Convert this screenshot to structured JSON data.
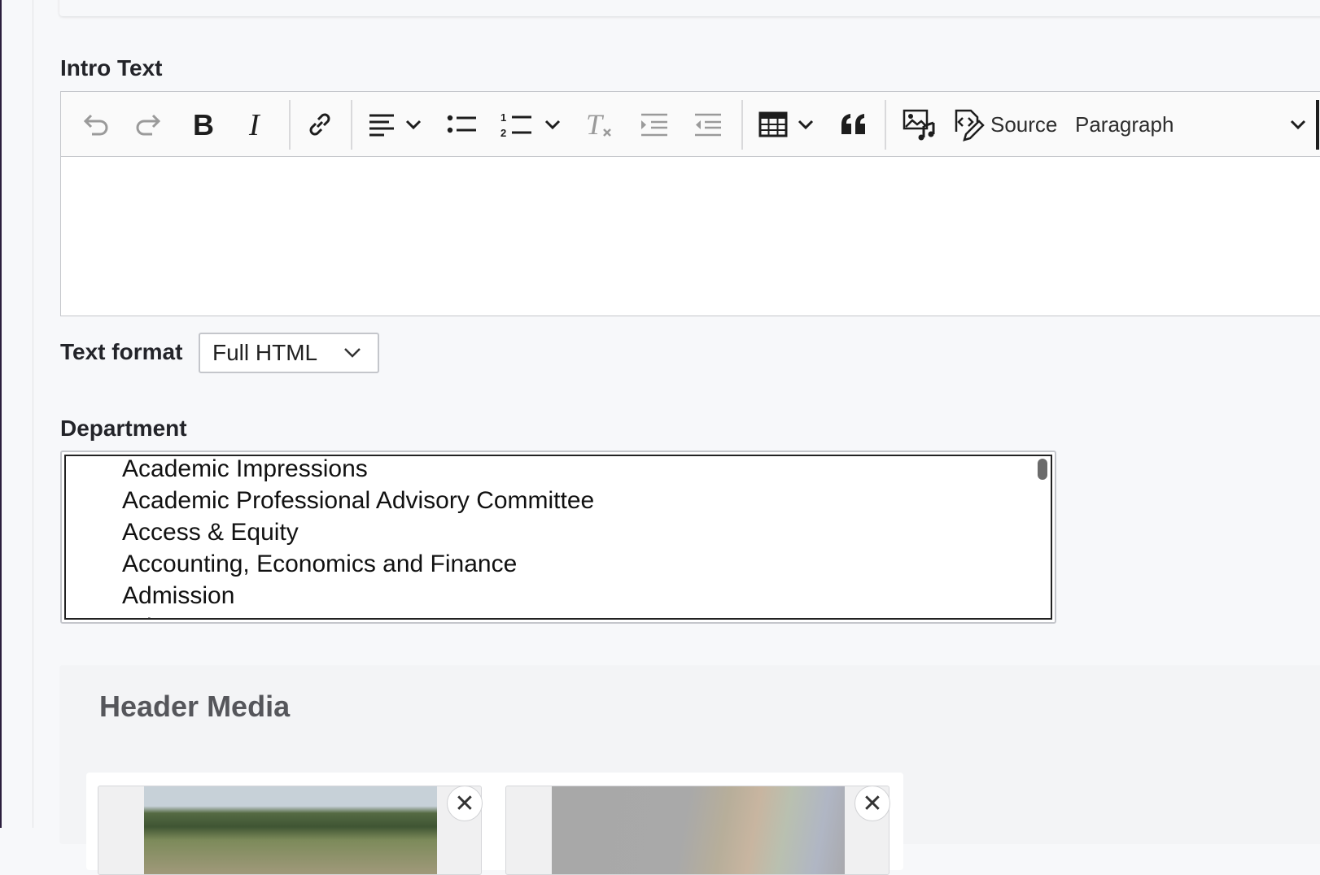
{
  "intro_text": {
    "label": "Intro Text",
    "toolbar": {
      "undo": "undo-icon",
      "redo": "redo-icon",
      "bold": "bold-icon",
      "italic": "italic-icon",
      "link": "link-icon",
      "align": "align-left-icon",
      "bulleted_list": "bulleted-list-icon",
      "numbered_list": "numbered-list-icon",
      "remove_format": "remove-format-icon",
      "indent": "indent-icon",
      "outdent": "outdent-icon",
      "table": "table-icon",
      "block_quote": "quote-icon",
      "media": "media-library-icon",
      "source_label": "Source",
      "heading_value": "Paragraph"
    }
  },
  "text_format": {
    "label": "Text format",
    "value": "Full HTML"
  },
  "department": {
    "label": "Department",
    "options": [
      "Academic Impressions",
      "Academic Professional Advisory Committee",
      "Access & Equity",
      "Accounting, Economics and Finance",
      "Admission",
      "Advancement"
    ]
  },
  "header_media": {
    "title": "Header Media",
    "remove_symbol": "✕"
  }
}
